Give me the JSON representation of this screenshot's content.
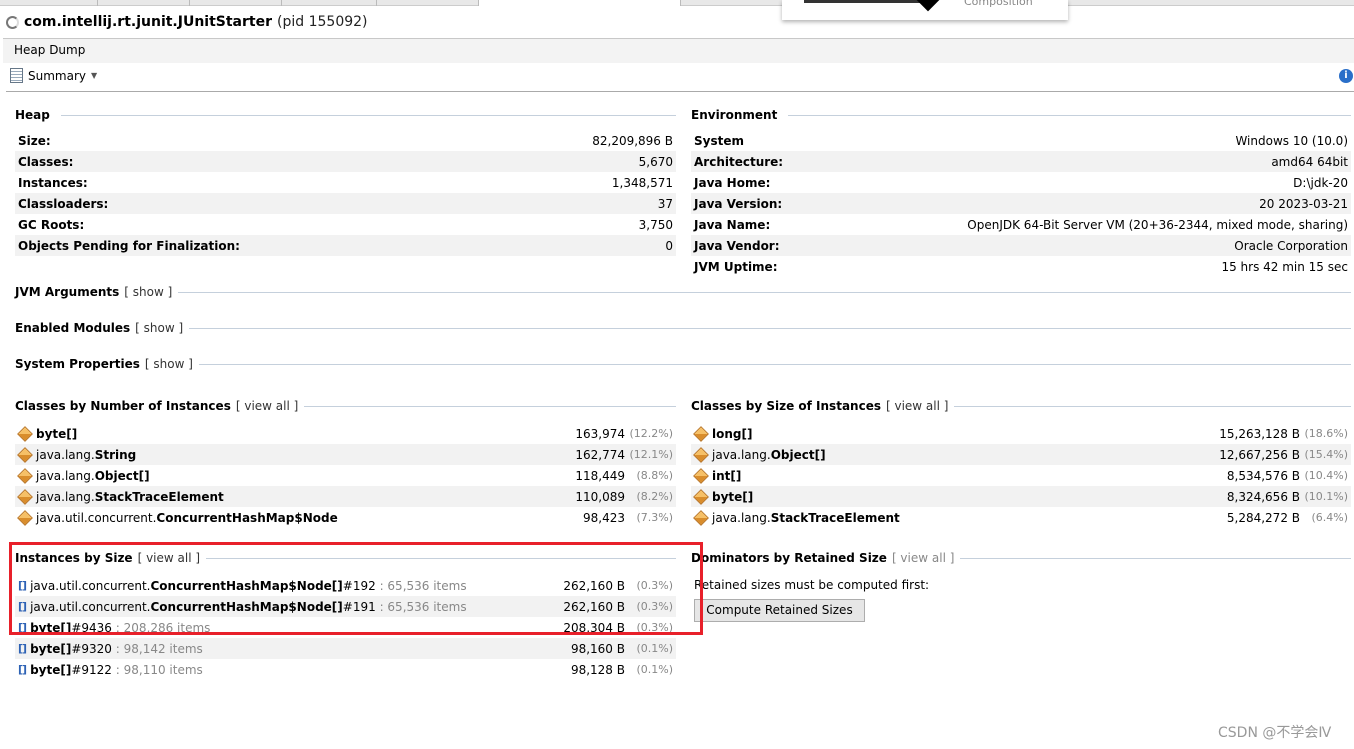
{
  "window": {
    "title": "com.intellij.rt.junit.JUnitStarter",
    "pid": "(pid 155092)",
    "overlay_label": "Composition"
  },
  "header": {
    "tab": "Heap Dump",
    "view": "Summary"
  },
  "heap": {
    "title": "Heap",
    "rows": [
      {
        "k": "Size:",
        "v": "82,209,896 B"
      },
      {
        "k": "Classes:",
        "v": "5,670"
      },
      {
        "k": "Instances:",
        "v": "1,348,571"
      },
      {
        "k": "Classloaders:",
        "v": "37"
      },
      {
        "k": "GC Roots:",
        "v": "3,750"
      },
      {
        "k": "Objects Pending for Finalization:",
        "v": "0"
      }
    ]
  },
  "environment": {
    "title": "Environment",
    "rows": [
      {
        "k": "System",
        "v": "Windows 10 (10.0)"
      },
      {
        "k": "Architecture:",
        "v": "amd64 64bit"
      },
      {
        "k": "Java Home:",
        "v": "D:\\jdk-20"
      },
      {
        "k": "Java Version:",
        "v": "20 2023-03-21"
      },
      {
        "k": "Java Name:",
        "v": "OpenJDK 64-Bit Server VM (20+36-2344, mixed mode, sharing)"
      },
      {
        "k": "Java Vendor:",
        "v": "Oracle Corporation"
      },
      {
        "k": "JVM Uptime:",
        "v": "15 hrs 42 min 15 sec"
      }
    ]
  },
  "jvm_args": {
    "title": "JVM Arguments",
    "link": "[ show ]"
  },
  "modules": {
    "title": "Enabled Modules",
    "link": "[ show ]"
  },
  "sysprops": {
    "title": "System Properties",
    "link": "[ show ]"
  },
  "by_count": {
    "title": "Classes by Number of Instances",
    "link": "[ view all ]",
    "rows": [
      {
        "pkg": "",
        "name": "byte[]",
        "v": "163,974",
        "pct": "(12.2%)"
      },
      {
        "pkg": "java.lang.",
        "name": "String",
        "v": "162,774",
        "pct": "(12.1%)"
      },
      {
        "pkg": "java.lang.",
        "name": "Object[]",
        "v": "118,449",
        "pct": "(8.8%)"
      },
      {
        "pkg": "java.lang.",
        "name": "StackTraceElement",
        "v": "110,089",
        "pct": "(8.2%)"
      },
      {
        "pkg": "java.util.concurrent.",
        "name": "ConcurrentHashMap$Node",
        "v": "98,423",
        "pct": "(7.3%)"
      }
    ]
  },
  "by_size": {
    "title": "Classes by Size of Instances",
    "link": "[ view all ]",
    "rows": [
      {
        "pkg": "",
        "name": "long[]",
        "v": "15,263,128 B",
        "pct": "(18.6%)"
      },
      {
        "pkg": "java.lang.",
        "name": "Object[]",
        "v": "12,667,256 B",
        "pct": "(15.4%)"
      },
      {
        "pkg": "",
        "name": "int[]",
        "v": "8,534,576 B",
        "pct": "(10.4%)"
      },
      {
        "pkg": "",
        "name": "byte[]",
        "v": "8,324,656 B",
        "pct": "(10.1%)"
      },
      {
        "pkg": "java.lang.",
        "name": "StackTraceElement",
        "v": "5,284,272 B",
        "pct": "(6.4%)"
      }
    ]
  },
  "instances": {
    "title": "Instances by Size",
    "link": "[ view all ]",
    "rows": [
      {
        "pkg": "java.util.concurrent.",
        "name": "ConcurrentHashMap$Node[]",
        "id": "#192",
        "items": ": 65,536 items",
        "v": "262,160 B",
        "pct": "(0.3%)"
      },
      {
        "pkg": "java.util.concurrent.",
        "name": "ConcurrentHashMap$Node[]",
        "id": "#191",
        "items": ": 65,536 items",
        "v": "262,160 B",
        "pct": "(0.3%)"
      },
      {
        "pkg": "",
        "name": "byte[]",
        "id": "#9436",
        "items": ": 208,286 items",
        "v": "208,304 B",
        "pct": "(0.3%)"
      },
      {
        "pkg": "",
        "name": "byte[]",
        "id": "#9320",
        "items": ": 98,142 items",
        "v": "98,160 B",
        "pct": "(0.1%)"
      },
      {
        "pkg": "",
        "name": "byte[]",
        "id": "#9122",
        "items": ": 98,110 items",
        "v": "98,128 B",
        "pct": "(0.1%)"
      }
    ]
  },
  "dominators": {
    "title": "Dominators by Retained Size",
    "link": "[ view all ]",
    "note": "Retained sizes must be computed first:",
    "button": "Compute Retained Sizes"
  },
  "watermark": "CSDN @不学会Ⅳ",
  "colors": {
    "highlight_box": "#e8202a",
    "accent": "#2a6fc9"
  }
}
